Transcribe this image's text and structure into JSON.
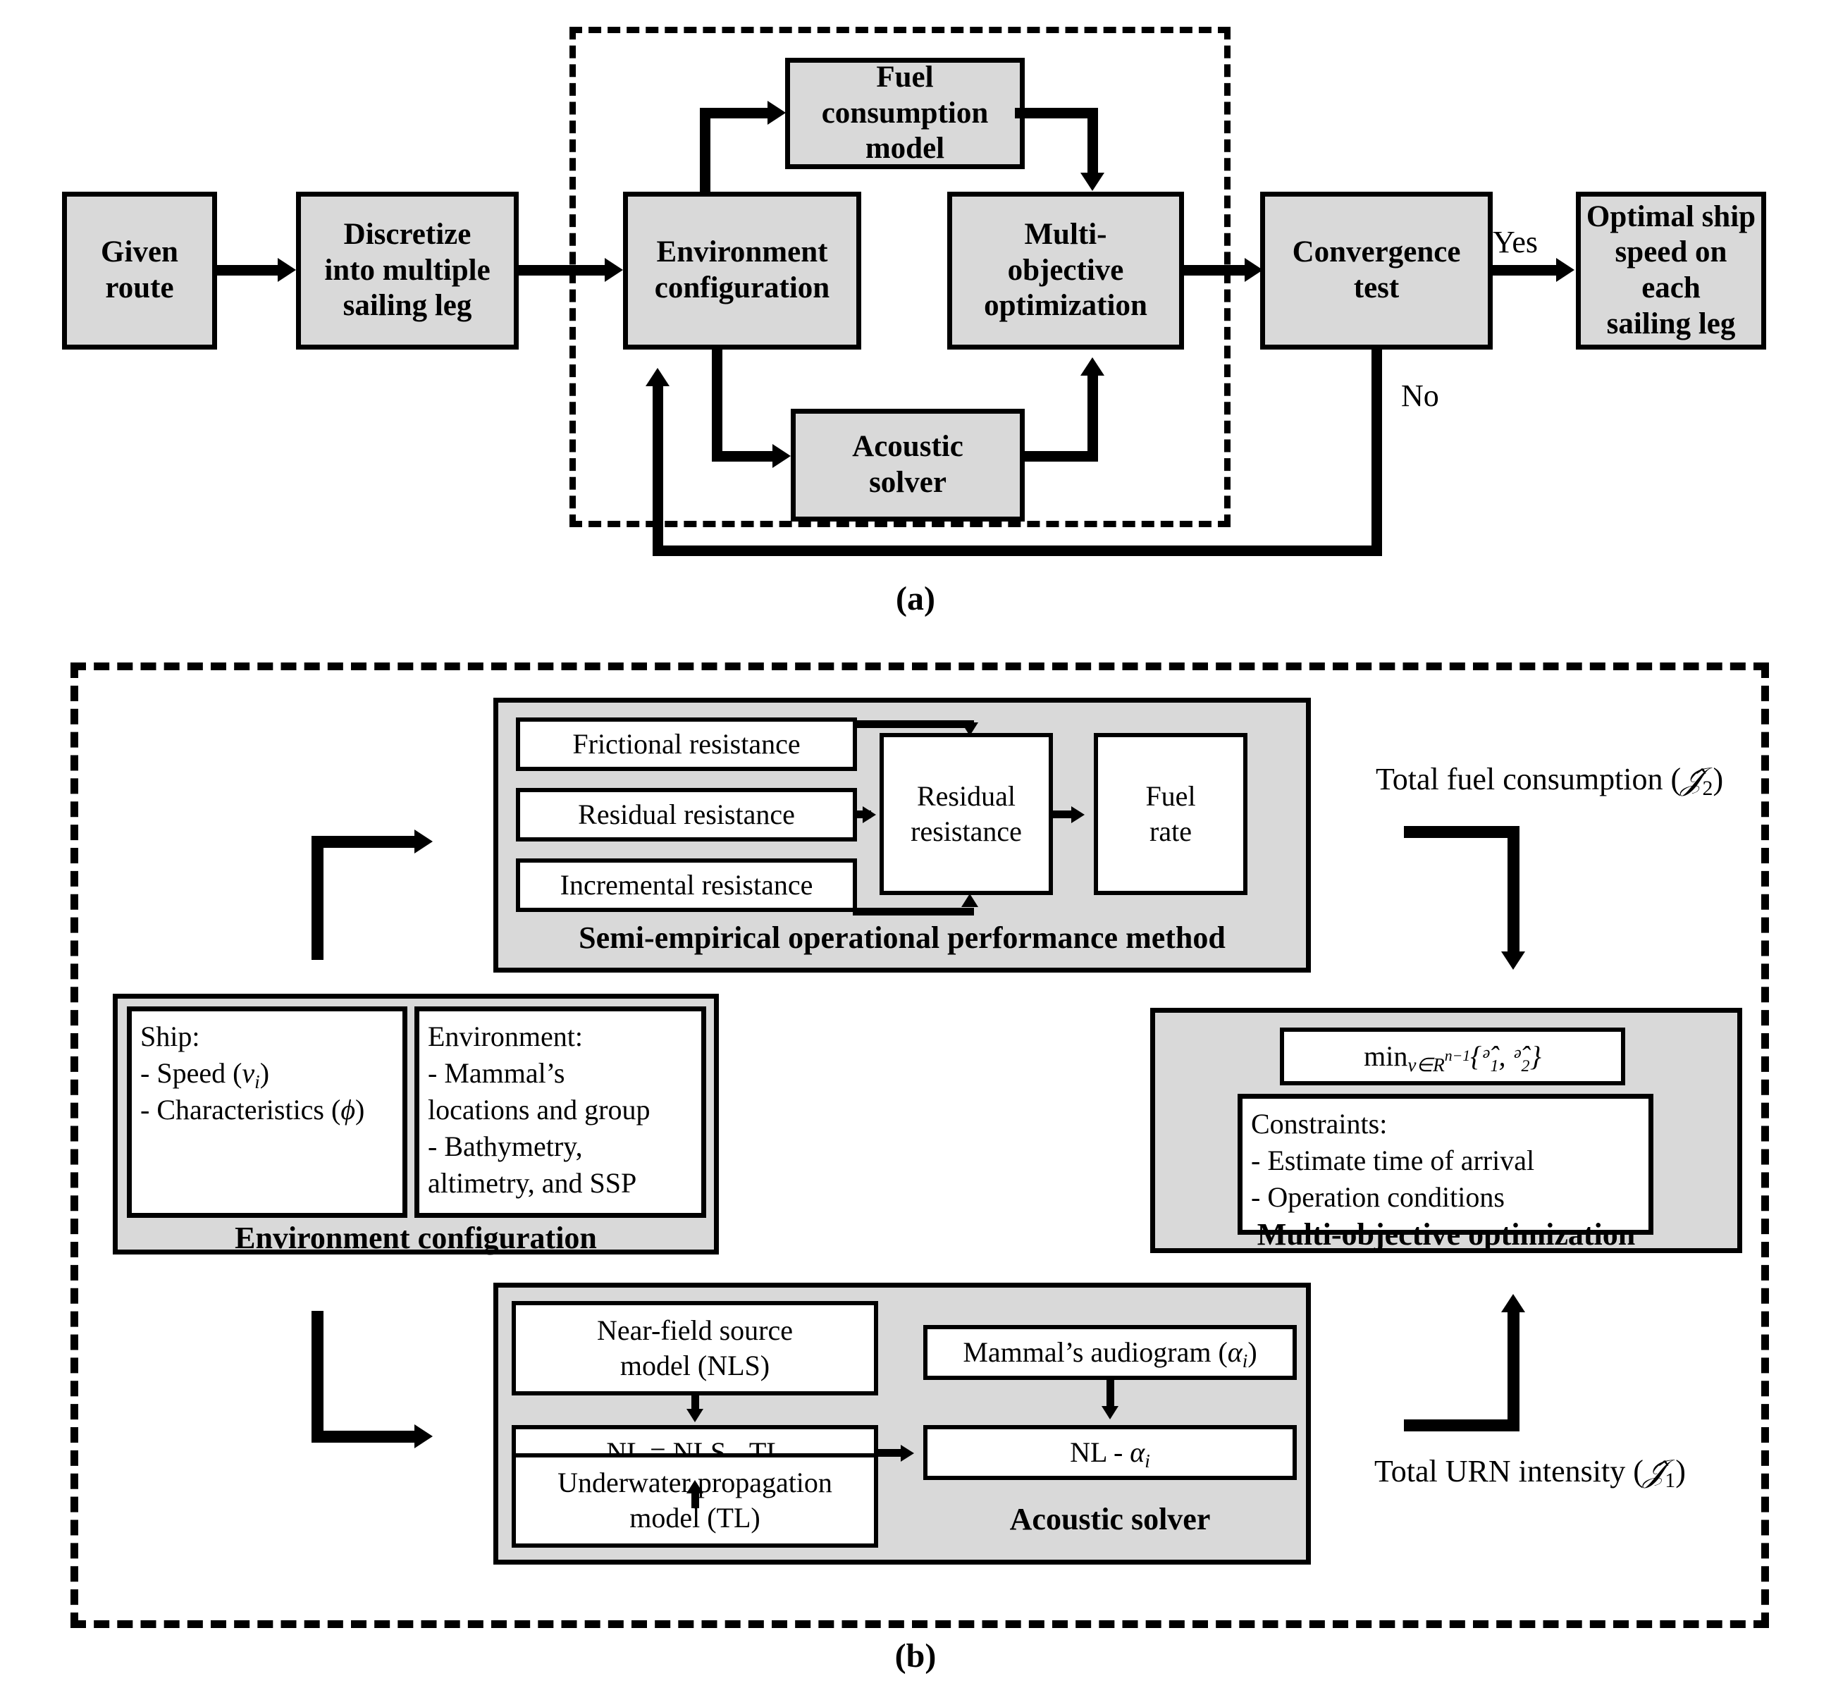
{
  "figure": {
    "panel_a_caption": "(a)",
    "panel_b_caption": "(b)"
  },
  "panel_a": {
    "boxes": {
      "given_route": "Given\nroute",
      "discretize": "Discretize\ninto multiple\nsailing leg",
      "fuel_consumption_model": "Fuel\nconsumption\nmodel",
      "environment_configuration": "Environment\nconfiguration",
      "multi_objective_optimization": "Multi-\nobjective\noptimization",
      "acoustic_solver": "Acoustic\nsolver",
      "convergence_test": "Convergence\ntest",
      "optimal_ship_speed": "Optimal ship\nspeed on\neach\nsailing leg"
    },
    "edge_labels": {
      "yes": "Yes",
      "no": "No"
    }
  },
  "panel_b": {
    "semi_empirical": {
      "title": "Semi-empirical operational performance method",
      "inputs": [
        "Frictional resistance",
        "Residual resistance",
        "Incremental resistance"
      ],
      "aggregate": "Residual\nresistance",
      "output": "Fuel\nrate"
    },
    "environment_configuration": {
      "title": "Environment configuration",
      "ship": {
        "heading": "Ship:",
        "items": [
          "- Speed (v",
          ")",
          "- Characteristics (",
          ")"
        ],
        "line1_pre": "- Speed (",
        "line1_var": "v",
        "line1_sub": "i",
        "line1_post": ")",
        "line2_pre": "- Characteristics (",
        "line2_var": "ϕ",
        "line2_post": ")"
      },
      "environment": {
        "heading": "Environment:",
        "lines": [
          "- Mammal’s",
          "locations and group",
          "- Bathymetry,",
          "altimetry, and SSP"
        ]
      }
    },
    "multi_objective": {
      "title": "Multi-objective optimization",
      "objective_min": "min",
      "objective_sub": "v∈R",
      "objective_sup": "n−1",
      "objective_set": "{ᵊ̂₁, ᵊ̂₂}",
      "objective_plain": "min_{v∈R^{n−1}}{Ä̉₁, Ä̉₂}",
      "constraints_heading": "Constraints:",
      "constraints": [
        "- Estimate time of arrival",
        "- Operation conditions"
      ]
    },
    "acoustic_solver": {
      "title": "Acoustic solver",
      "near_field": "Near-field source\nmodel (NLS)",
      "underwater": "Underwater propagation\nmodel (TL)",
      "nl_equation": "NL = NLS - TL",
      "audiogram_pre": "Mammal’s audiogram (",
      "audiogram_var": "α",
      "audiogram_sub": "i",
      "audiogram_post": ")",
      "nl_alpha_pre": "NL - ",
      "nl_alpha_var": "α",
      "nl_alpha_sub": "i"
    },
    "outputs": {
      "total_fuel_pre": "Total fuel consumption (",
      "total_fuel_sym": "𝒥̂",
      "total_fuel_sub": "2",
      "total_fuel_post": ")",
      "total_urn_pre": "Total URN intensity (",
      "total_urn_sym": "𝒥̂",
      "total_urn_sub": "1",
      "total_urn_post": ")"
    }
  },
  "colors": {
    "box_fill": "#d9d9d9",
    "box_stroke": "#000000",
    "white_fill": "#ffffff",
    "background": "#ffffff"
  }
}
